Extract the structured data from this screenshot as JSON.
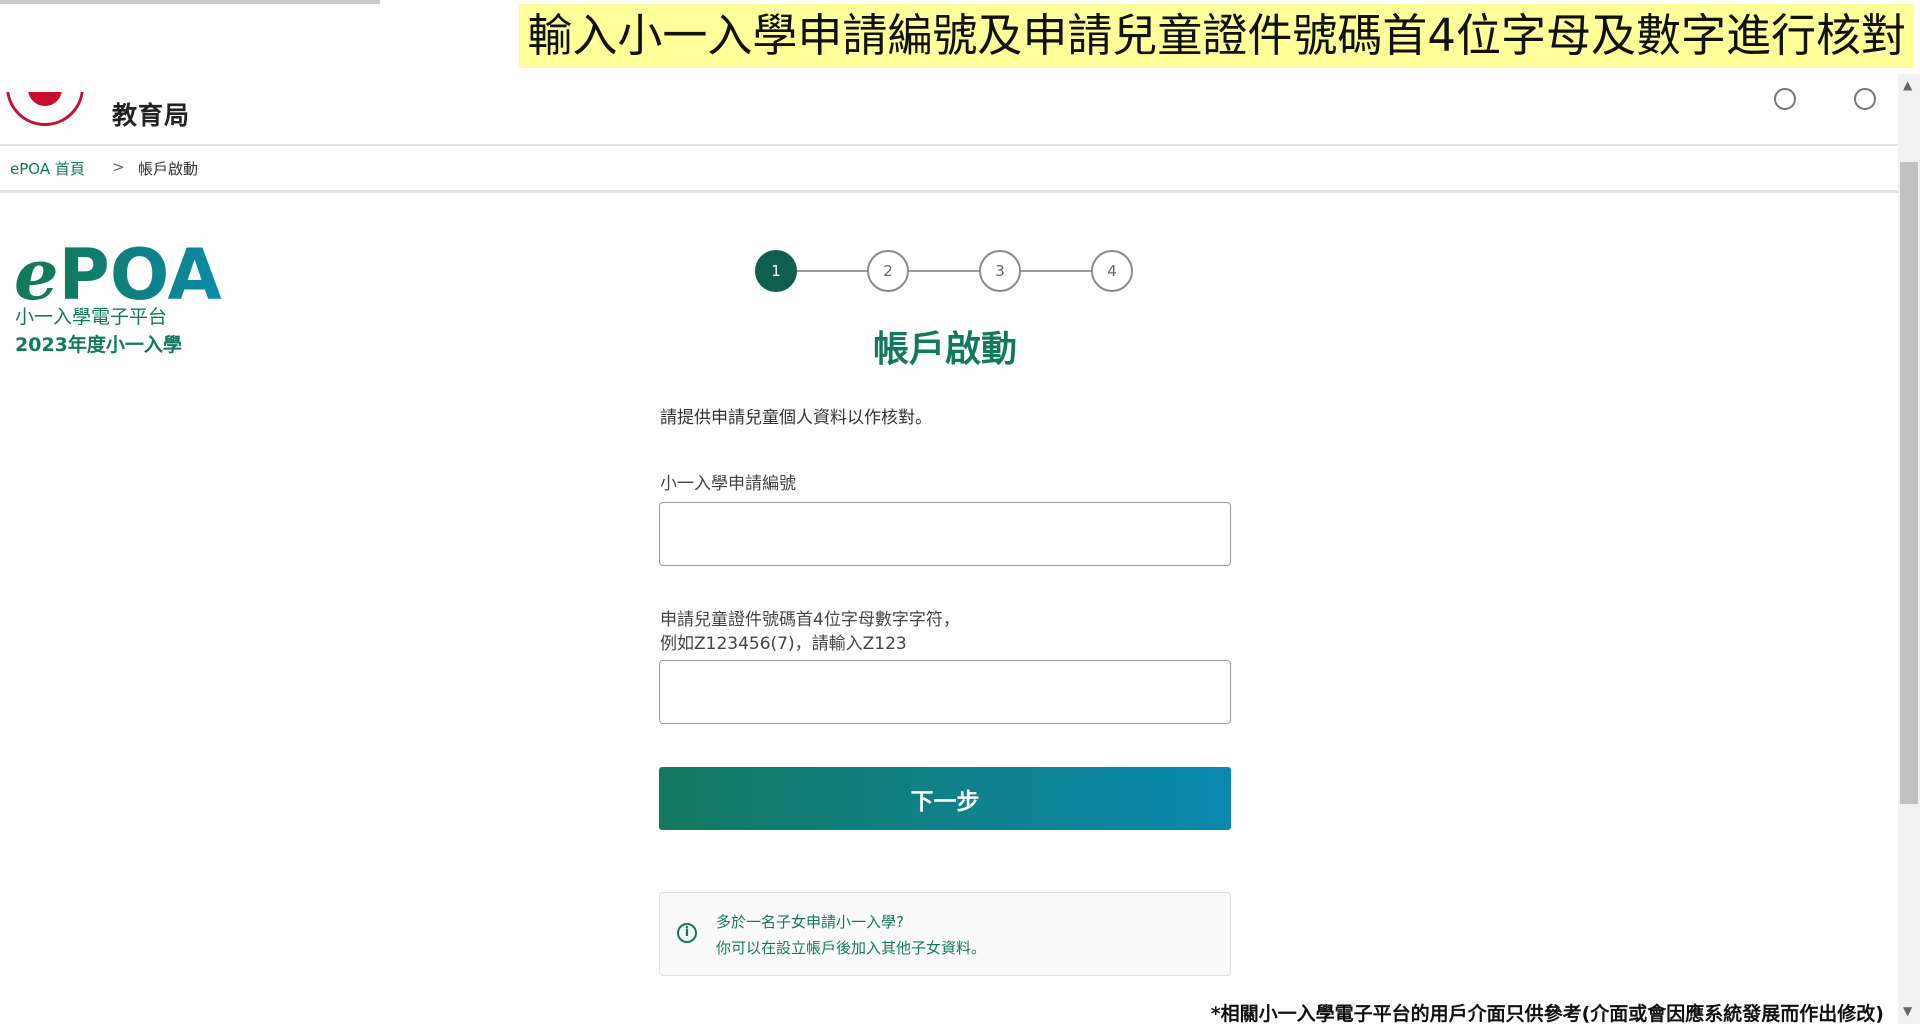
{
  "video_caption": "輸入小一入學申請編號及申請兒童證件號碼首4位字母及數字進行核對",
  "header": {
    "agency_name": "教育局"
  },
  "breadcrumb": {
    "home": "ePOA 首頁",
    "separator": ">",
    "current": "帳戶啟動"
  },
  "brand": {
    "mark_e": "e",
    "mark_poa": "POA",
    "subtitle": "小一入學電子平台",
    "year": "2023年度小一入學"
  },
  "stepper": {
    "steps": [
      "1",
      "2",
      "3",
      "4"
    ],
    "active_step": 1
  },
  "form": {
    "heading": "帳戶啟動",
    "intro": "請提供申請兒童個人資料以作核對。",
    "application_no_label": "小一入學申請編號",
    "application_no_value": "",
    "id_prefix_label_line1": "申請兒童證件號碼首4位字母數字字符，",
    "id_prefix_label_line2": "例如Z123456(7)，請輸入Z123",
    "id_prefix_value": "",
    "next_button": "下一步"
  },
  "notice": {
    "icon": "info-icon",
    "line1": "多於一名子女申請小一入學?",
    "line2": "你可以在設立帳戶後加入其他子女資料。"
  },
  "footnote": "*相關小一入學電子平台的用戶介面只供參考(介面或會因應系統發展而作出修改)",
  "colors": {
    "brand_green": "#12795f",
    "active_step": "#0f5f4d",
    "caption_bg": "#ffff99",
    "button_gradient_end": "#0b88b0"
  }
}
